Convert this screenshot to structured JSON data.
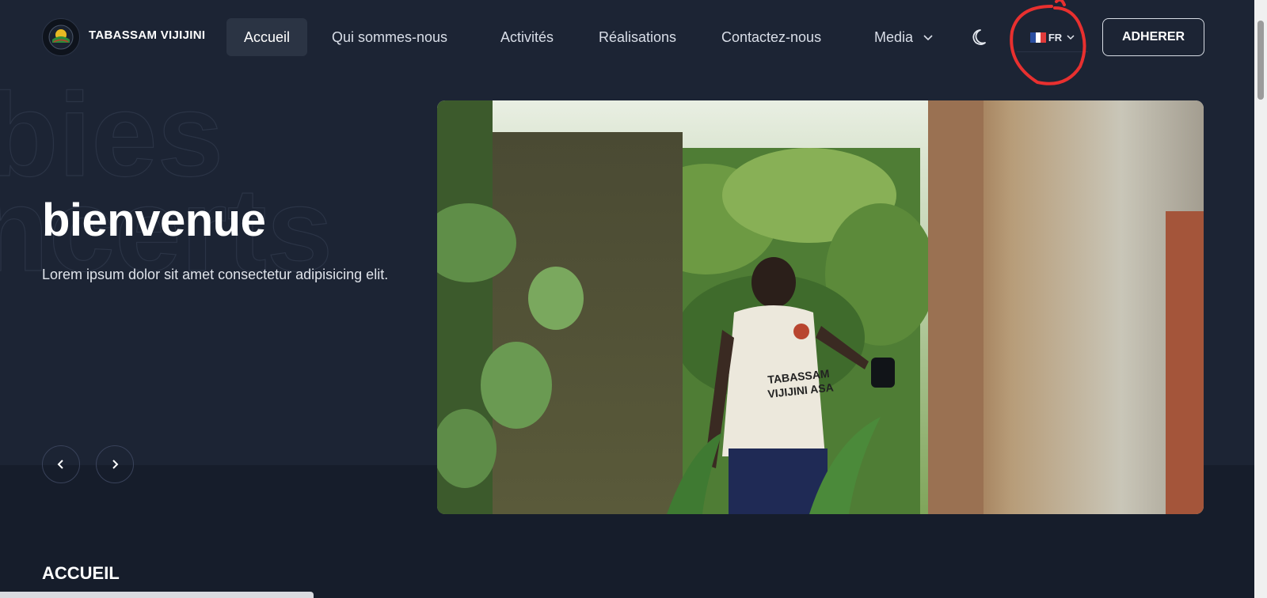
{
  "header": {
    "brand": "TABASSAM VIJIJINI",
    "nav": [
      {
        "label": "Accueil",
        "active": true
      },
      {
        "label": "Qui sommes-nous"
      },
      {
        "label": "Activités"
      },
      {
        "label": "Réalisations"
      },
      {
        "label": "Contactez-nous"
      },
      {
        "label": "Media",
        "dropdown": true
      }
    ],
    "theme_icon": "moon-icon",
    "language": {
      "code": "FR",
      "flag": "france-flag-icon"
    },
    "cta_label": "ADHERER"
  },
  "hero": {
    "title": "bienvenue",
    "subtitle": "Lorem ipsum dolor sit amet consectetur adipisicing elit.",
    "background_words": [
      "bies",
      "ncerts"
    ],
    "prev_icon": "chevron-left-icon",
    "next_icon": "chevron-right-icon"
  },
  "section": {
    "title": "ACCUEIL"
  },
  "colors": {
    "background": "#1c2434",
    "lower_band": "#161d2b",
    "active_nav": "#2b3444",
    "annotation": "#e8302f"
  }
}
